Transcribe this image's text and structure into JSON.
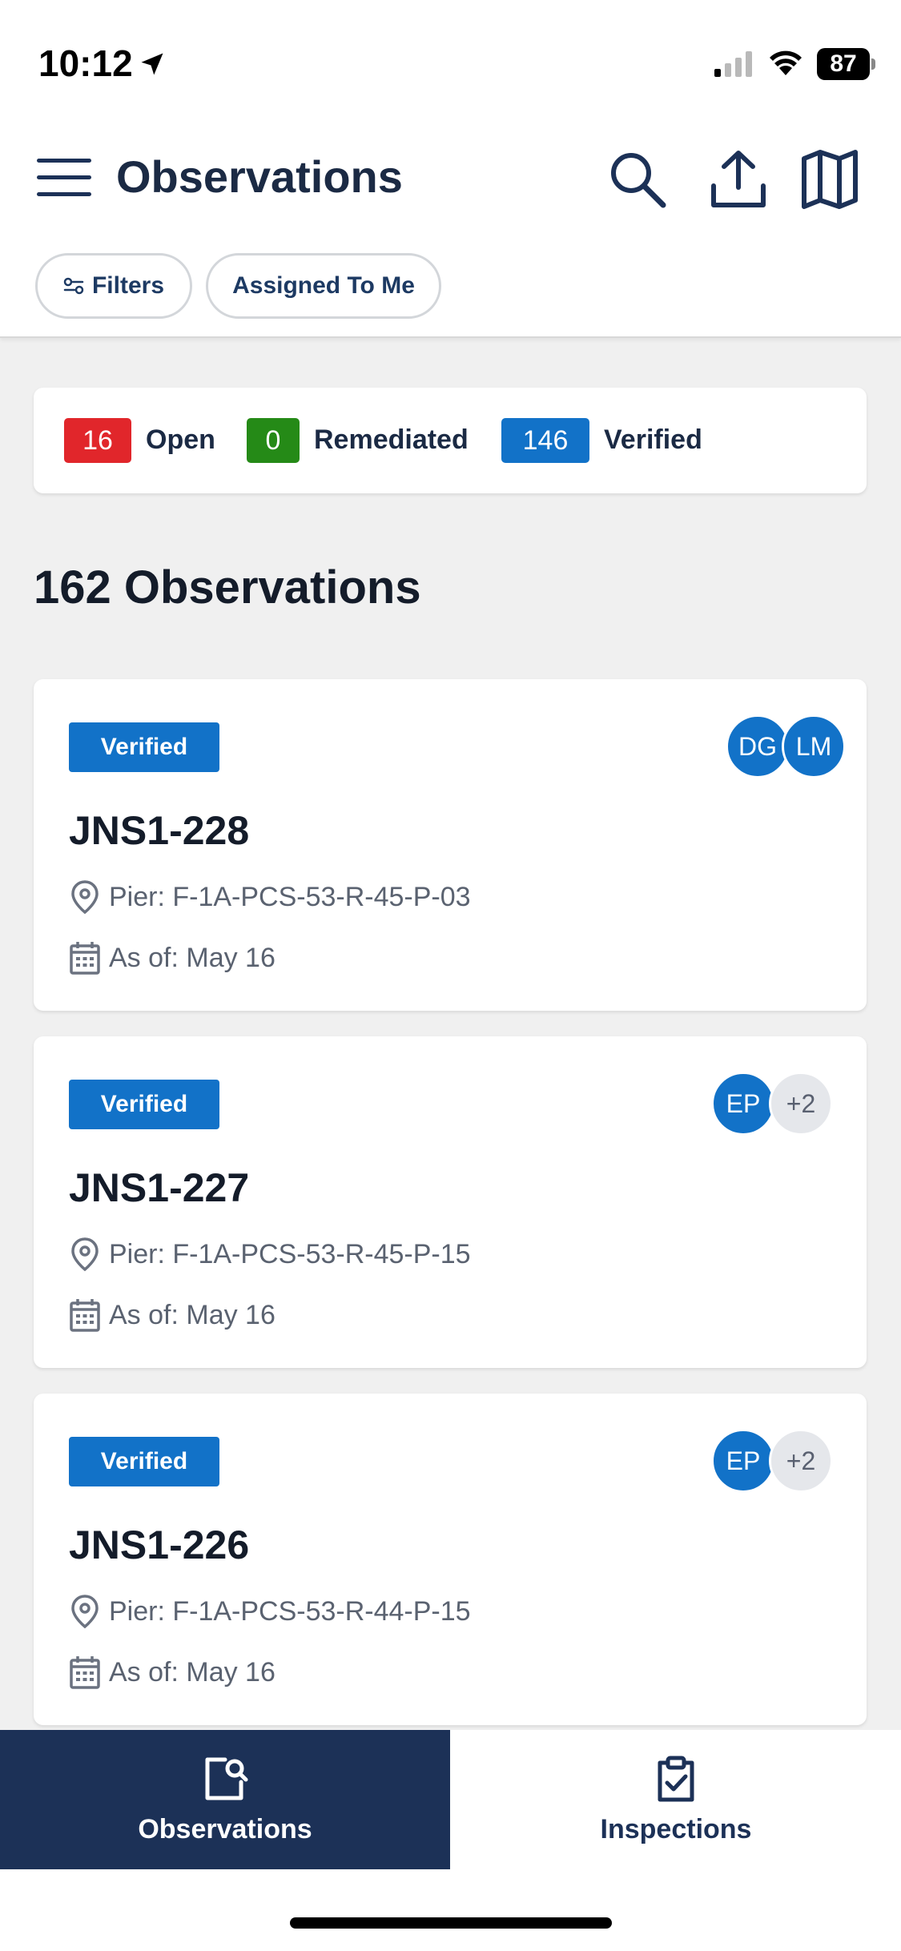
{
  "status_bar": {
    "time": "10:12",
    "battery": "87"
  },
  "header": {
    "title": "Observations",
    "menu_icon": "hamburger-menu-icon",
    "actions": [
      "search-icon",
      "upload-icon",
      "map-icon"
    ],
    "filters_label": "Filters",
    "assigned_label": "Assigned To Me"
  },
  "summary": {
    "open_count": "16",
    "open_label": "Open",
    "open_color": "#e1262b",
    "remediated_count": "0",
    "remediated_label": "Remediated",
    "remediated_color": "#258a17",
    "verified_count": "146",
    "verified_label": "Verified",
    "verified_color": "#1272c8"
  },
  "list_heading": "162 Observations",
  "observations": [
    {
      "status": "Verified",
      "id": "JNS1-228",
      "location": "Pier: F-1A-PCS-53-R-45-P-03",
      "date": "As of: May 16",
      "avatars": [
        "DG",
        "LM"
      ]
    },
    {
      "status": "Verified",
      "id": "JNS1-227",
      "location": "Pier: F-1A-PCS-53-R-45-P-15",
      "date": "As of: May 16",
      "avatars": [
        "EP",
        "+2"
      ]
    },
    {
      "status": "Verified",
      "id": "JNS1-226",
      "location": "Pier: F-1A-PCS-53-R-44-P-15",
      "date": "As of: May 16",
      "avatars": [
        "EP",
        "+2"
      ]
    }
  ],
  "tabs": [
    {
      "label": "Observations",
      "icon": "observations-icon",
      "active": true
    },
    {
      "label": "Inspections",
      "icon": "clipboard-check-icon",
      "active": false
    }
  ]
}
